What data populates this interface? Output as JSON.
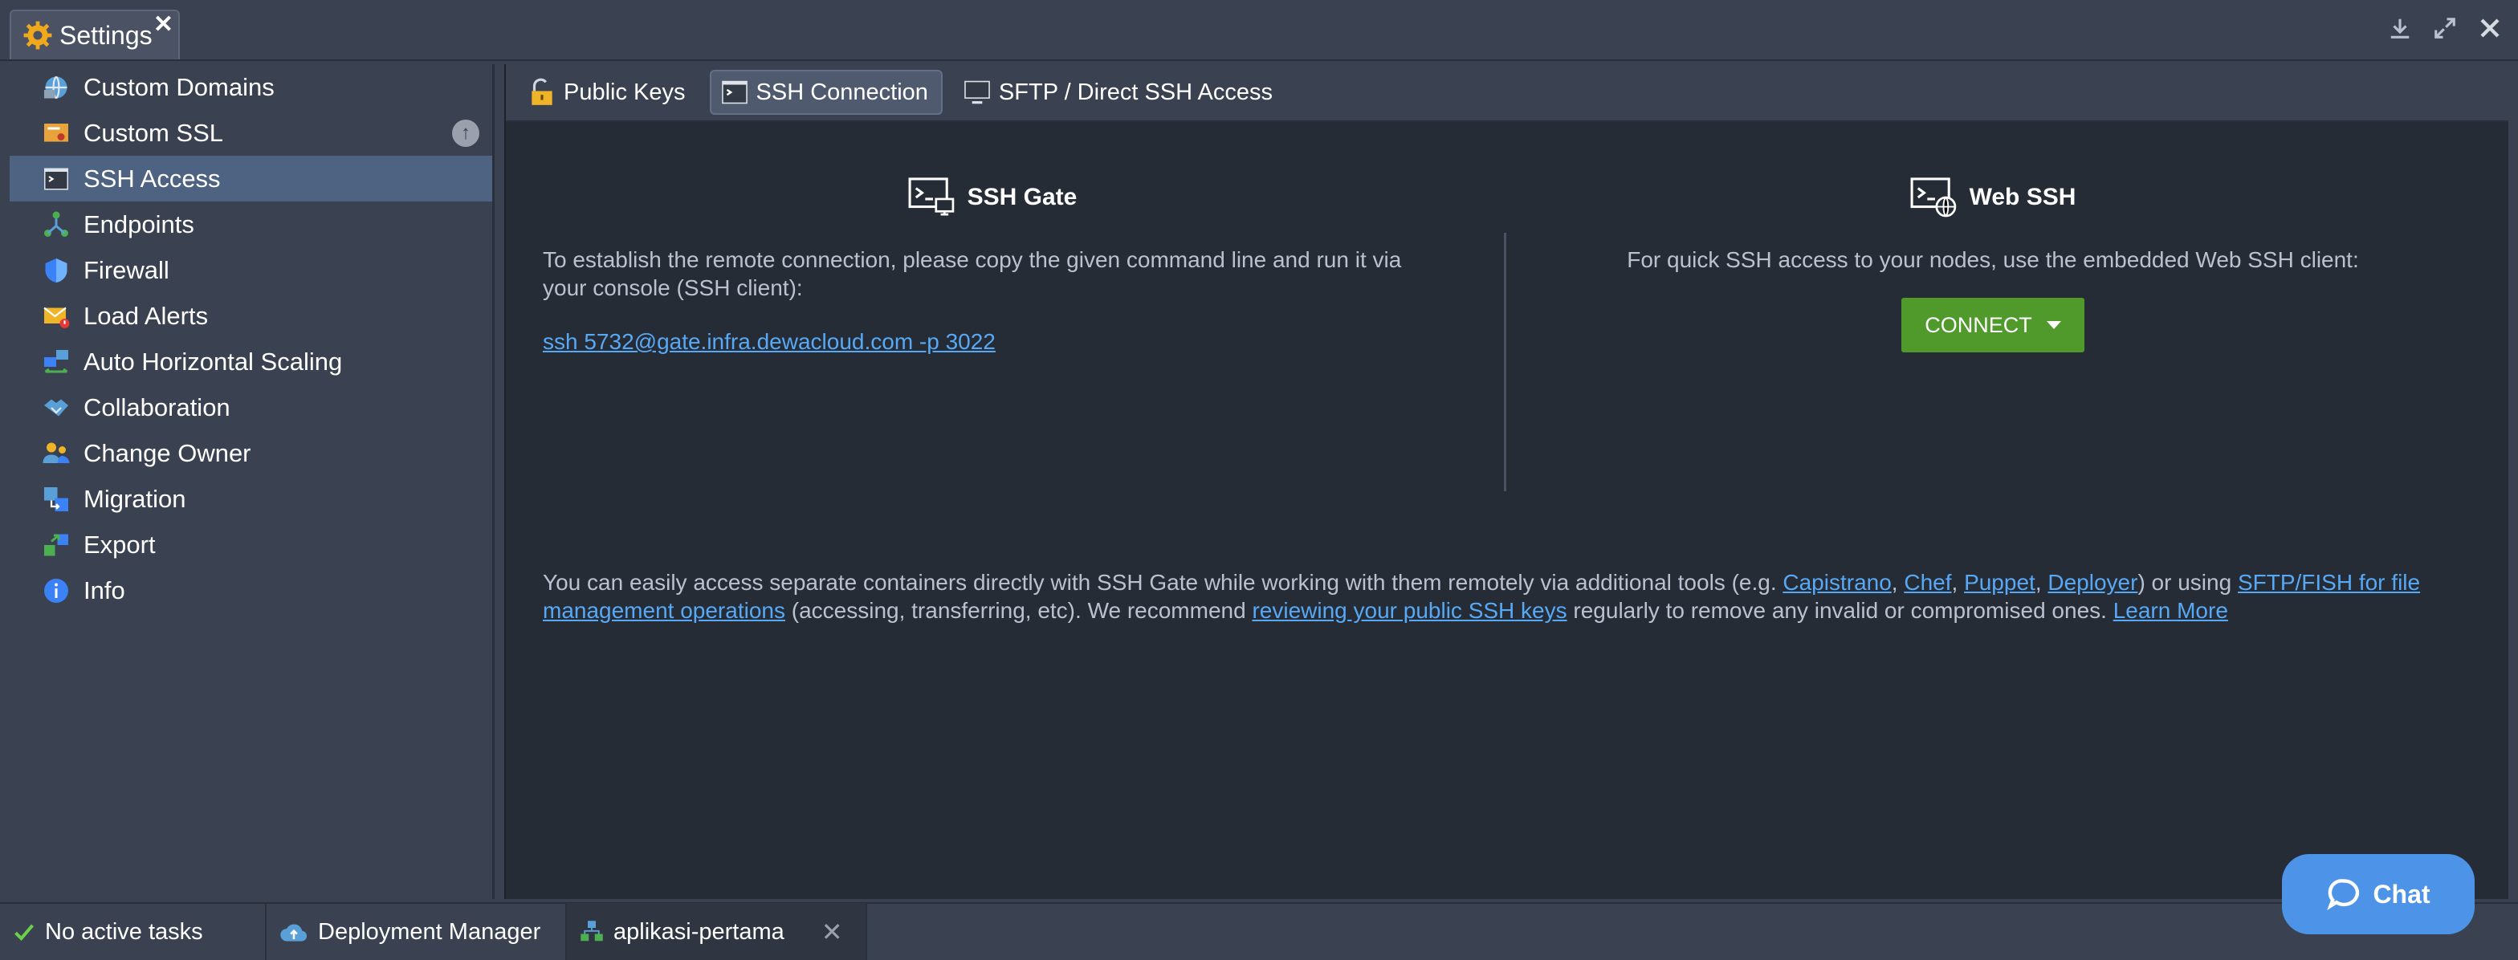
{
  "window": {
    "tab_title": "Settings",
    "tab_close": "✕"
  },
  "sidebar": {
    "items": [
      {
        "label": "Custom Domains",
        "icon": "globe-icon"
      },
      {
        "label": "Custom SSL",
        "icon": "certificate-icon"
      },
      {
        "label": "SSH Access",
        "icon": "terminal-icon"
      },
      {
        "label": "Endpoints",
        "icon": "endpoints-icon"
      },
      {
        "label": "Firewall",
        "icon": "shield-icon"
      },
      {
        "label": "Load Alerts",
        "icon": "alert-mail-icon"
      },
      {
        "label": "Auto Horizontal Scaling",
        "icon": "scaling-icon"
      },
      {
        "label": "Collaboration",
        "icon": "handshake-icon"
      },
      {
        "label": "Change Owner",
        "icon": "users-icon"
      },
      {
        "label": "Migration",
        "icon": "migration-icon"
      },
      {
        "label": "Export",
        "icon": "export-icon"
      },
      {
        "label": "Info",
        "icon": "info-icon"
      }
    ],
    "active_index": 2
  },
  "tabs": [
    {
      "label": "Public Keys",
      "icon": "lock-icon"
    },
    {
      "label": "SSH Connection",
      "icon": "terminal-icon"
    },
    {
      "label": "SFTP / Direct SSH Access",
      "icon": "monitor-icon"
    }
  ],
  "ssh_gate": {
    "title": "SSH Gate",
    "description": "To establish the remote connection, please copy the given command line and run it via your console (SSH client):",
    "command": "ssh 5732@gate.infra.dewacloud.com -p 3022"
  },
  "web_ssh": {
    "title": "Web SSH",
    "description": "For quick SSH access to your nodes, use the embedded Web SSH client:",
    "connect_label": "CONNECT"
  },
  "note": {
    "t1": "You can easily access separate containers directly with SSH Gate while working with them remotely via additional tools (e.g. ",
    "capistrano": "Capistrano",
    "comma1": ", ",
    "chef": "Chef",
    "comma2": ", ",
    "puppet": "Puppet",
    "comma3": ", ",
    "deployer": "Deployer",
    "t2": ") or using ",
    "sftp_link": "SFTP/FISH for file management operations",
    "t3": " (accessing, transferring, etc). We recommend ",
    "review_link": "reviewing your public SSH keys",
    "t4": " regularly to remove any invalid or compromised ones. ",
    "learn_more": "Learn More"
  },
  "statusbar": {
    "tasks": "No active tasks",
    "deployment_manager": "Deployment Manager",
    "environment": "aplikasi-pertama",
    "env_close": "✕"
  },
  "chat": {
    "label": "Chat"
  },
  "colors": {
    "accent_blue": "#58a9f5",
    "connect_green": "#4f9a2b",
    "active_row": "#4d6381",
    "chat": "#4d94e8"
  }
}
